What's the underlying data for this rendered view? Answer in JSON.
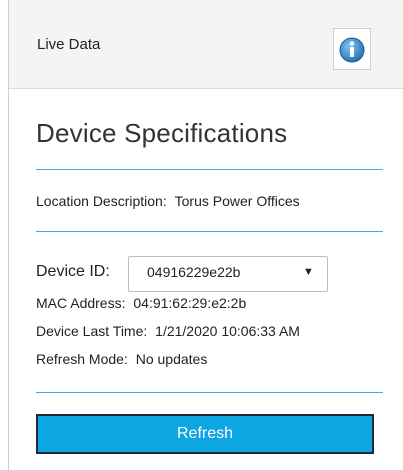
{
  "header": {
    "title": "Live Data",
    "info_icon": "info-icon"
  },
  "specs": {
    "title": "Device Specifications",
    "location_label": "Location Description:",
    "location_value": "Torus Power Offices",
    "device_id_label": "Device ID:",
    "device_id_value": "04916229e22b",
    "dropdown_icon": "caret-down-icon",
    "mac_label": "MAC Address:",
    "mac_value": "04:91:62:29:e2:2b",
    "last_time_label": "Device Last Time:",
    "last_time_value": "1/21/2020 10:06:33 AM",
    "refresh_mode_label": "Refresh Mode:",
    "refresh_mode_value": "No updates"
  },
  "actions": {
    "refresh_label": "Refresh"
  },
  "colors": {
    "accent": "#35b3e5",
    "button": "#0ea6e1",
    "info_icon": "#1f6fb5"
  }
}
